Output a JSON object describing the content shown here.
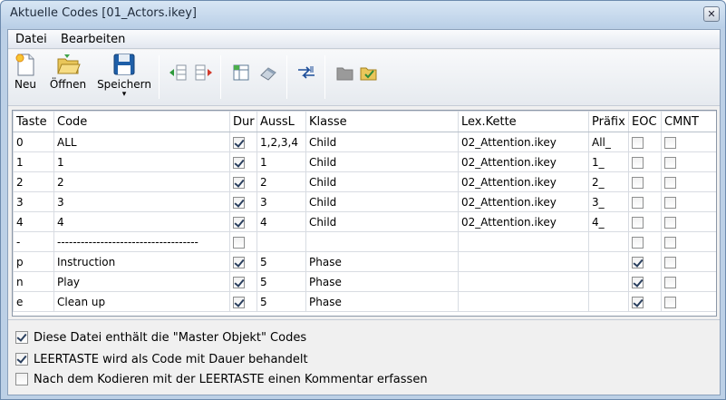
{
  "window": {
    "title": "Aktuelle Codes [01_Actors.ikey]",
    "close_glyph": "✕"
  },
  "menu": [
    "Datei",
    "Bearbeiten"
  ],
  "toolbar": {
    "new_label": "Neu",
    "open_label": "Öffnen",
    "save_label": "Speichern",
    "dropdown_glyph": "▾"
  },
  "table": {
    "headers": [
      "Taste",
      "Code",
      "Dur",
      "AussL",
      "Klasse",
      "Lex.Kette",
      "Präfix",
      "EOC",
      "CMNT"
    ],
    "rows": [
      {
        "taste": "0",
        "code": "ALL",
        "dur": true,
        "aussl": "1,2,3,4",
        "klasse": "Child",
        "lex": "02_Attention.ikey",
        "praefix": "All_",
        "eoc": false,
        "cmnt": false
      },
      {
        "taste": "1",
        "code": "1",
        "dur": true,
        "aussl": "1",
        "klasse": "Child",
        "lex": "02_Attention.ikey",
        "praefix": "1_",
        "eoc": false,
        "cmnt": false
      },
      {
        "taste": "2",
        "code": "2",
        "dur": true,
        "aussl": "2",
        "klasse": "Child",
        "lex": "02_Attention.ikey",
        "praefix": "2_",
        "eoc": false,
        "cmnt": false
      },
      {
        "taste": "3",
        "code": "3",
        "dur": true,
        "aussl": "3",
        "klasse": "Child",
        "lex": "02_Attention.ikey",
        "praefix": "3_",
        "eoc": false,
        "cmnt": false
      },
      {
        "taste": "4",
        "code": "4",
        "dur": true,
        "aussl": "4",
        "klasse": "Child",
        "lex": "02_Attention.ikey",
        "praefix": "4_",
        "eoc": false,
        "cmnt": false
      },
      {
        "taste": "-",
        "code": "------------------------------------",
        "dur": false,
        "aussl": "",
        "klasse": "",
        "lex": "",
        "praefix": "",
        "eoc": false,
        "cmnt": false
      },
      {
        "taste": "p",
        "code": "Instruction",
        "dur": true,
        "aussl": "5",
        "klasse": "Phase",
        "lex": "",
        "praefix": "",
        "eoc": true,
        "cmnt": false
      },
      {
        "taste": "n",
        "code": "Play",
        "dur": true,
        "aussl": "5",
        "klasse": "Phase",
        "lex": "",
        "praefix": "",
        "eoc": true,
        "cmnt": false
      },
      {
        "taste": "e",
        "code": "Clean up",
        "dur": true,
        "aussl": "5",
        "klasse": "Phase",
        "lex": "",
        "praefix": "",
        "eoc": true,
        "cmnt": false
      }
    ]
  },
  "options": [
    {
      "label": "Diese Datei enthält die \"Master Objekt\" Codes",
      "checked": true
    },
    {
      "label": "LEERTASTE wird als Code mit Dauer behandelt",
      "checked": true
    },
    {
      "label": "Nach dem Kodieren mit der LEERTASTE einen Kommentar erfassen",
      "checked": false
    }
  ]
}
